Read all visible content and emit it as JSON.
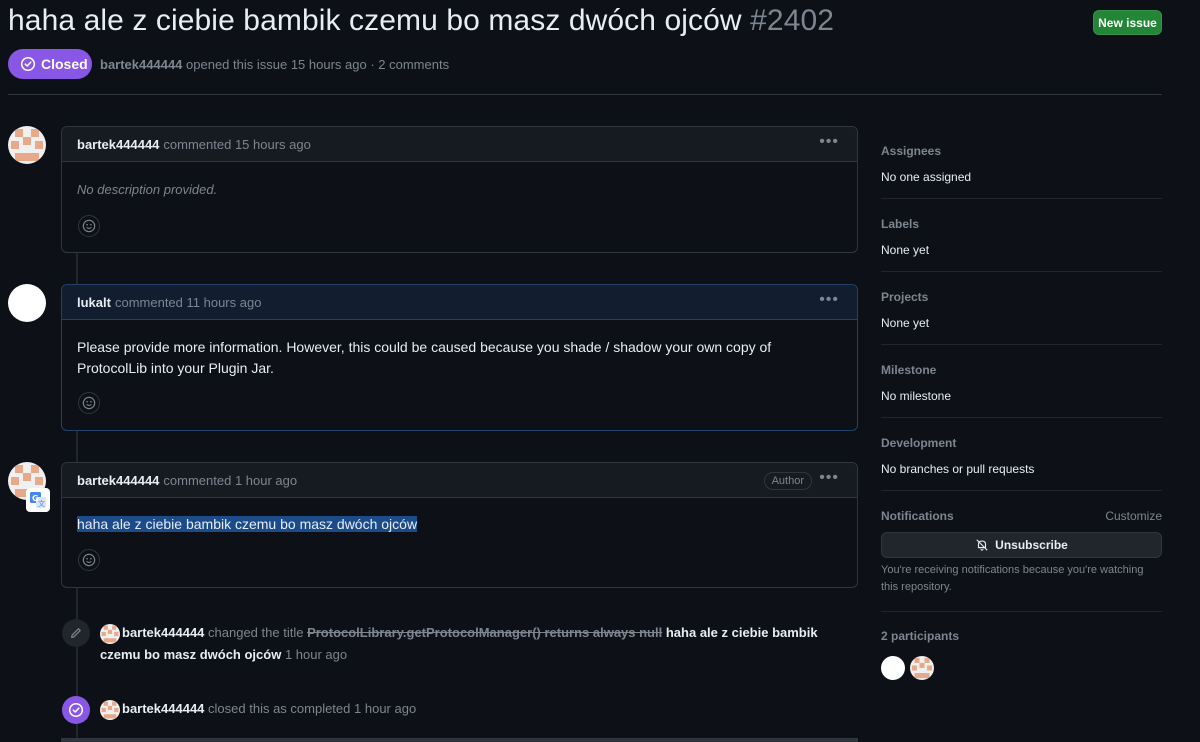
{
  "issue": {
    "title": "haha ale z ciebie bambik czemu bo masz dwóch ojców",
    "number": "#2402",
    "state": "Closed",
    "author": "bartek444444",
    "meta_rest": "opened this issue 15 hours ago · 2 comments",
    "new_issue_label": "New issue"
  },
  "comments": [
    {
      "author": "bartek444444",
      "action": "commented 15 hours ago",
      "body": "No description provided."
    },
    {
      "author": "lukalt",
      "action": "commented 11 hours ago",
      "body": "Please provide more information. However, this could be caused because you shade / shadow your own copy of ProtocolLib into your Plugin Jar."
    },
    {
      "author": "bartek444444",
      "action": "commented 1 hour ago",
      "badge": "Author",
      "body": "haha ale z ciebie bambik czemu bo masz dwóch ojców"
    }
  ],
  "events": {
    "rename": {
      "actor": "bartek444444",
      "action": "changed the title",
      "old_title": "ProtocolLibrary.getProtocolManager() returns always null",
      "new_title": "haha ale z ciebie bambik czemu bo masz dwóch ojców",
      "time": "1 hour ago"
    },
    "closed": {
      "actor": "bartek444444",
      "action": "closed this as completed",
      "time": "1 hour ago"
    }
  },
  "sidebar": {
    "assignees": {
      "label": "Assignees",
      "value": "No one assigned"
    },
    "labels": {
      "label": "Labels",
      "value": "None yet"
    },
    "projects": {
      "label": "Projects",
      "value": "None yet"
    },
    "milestone": {
      "label": "Milestone",
      "value": "No milestone"
    },
    "development": {
      "label": "Development",
      "value": "No branches or pull requests"
    },
    "notifications": {
      "label": "Notifications",
      "customize": "Customize",
      "button": "Unsubscribe",
      "info": "You're receiving notifications because you're watching this repository."
    },
    "participants": {
      "label": "2 participants"
    }
  },
  "colors": {
    "background": "#0d1117",
    "closed_purple": "#8957e5",
    "new_issue_green": "#238636",
    "border": "#30363d",
    "muted_text": "#7d8590"
  }
}
